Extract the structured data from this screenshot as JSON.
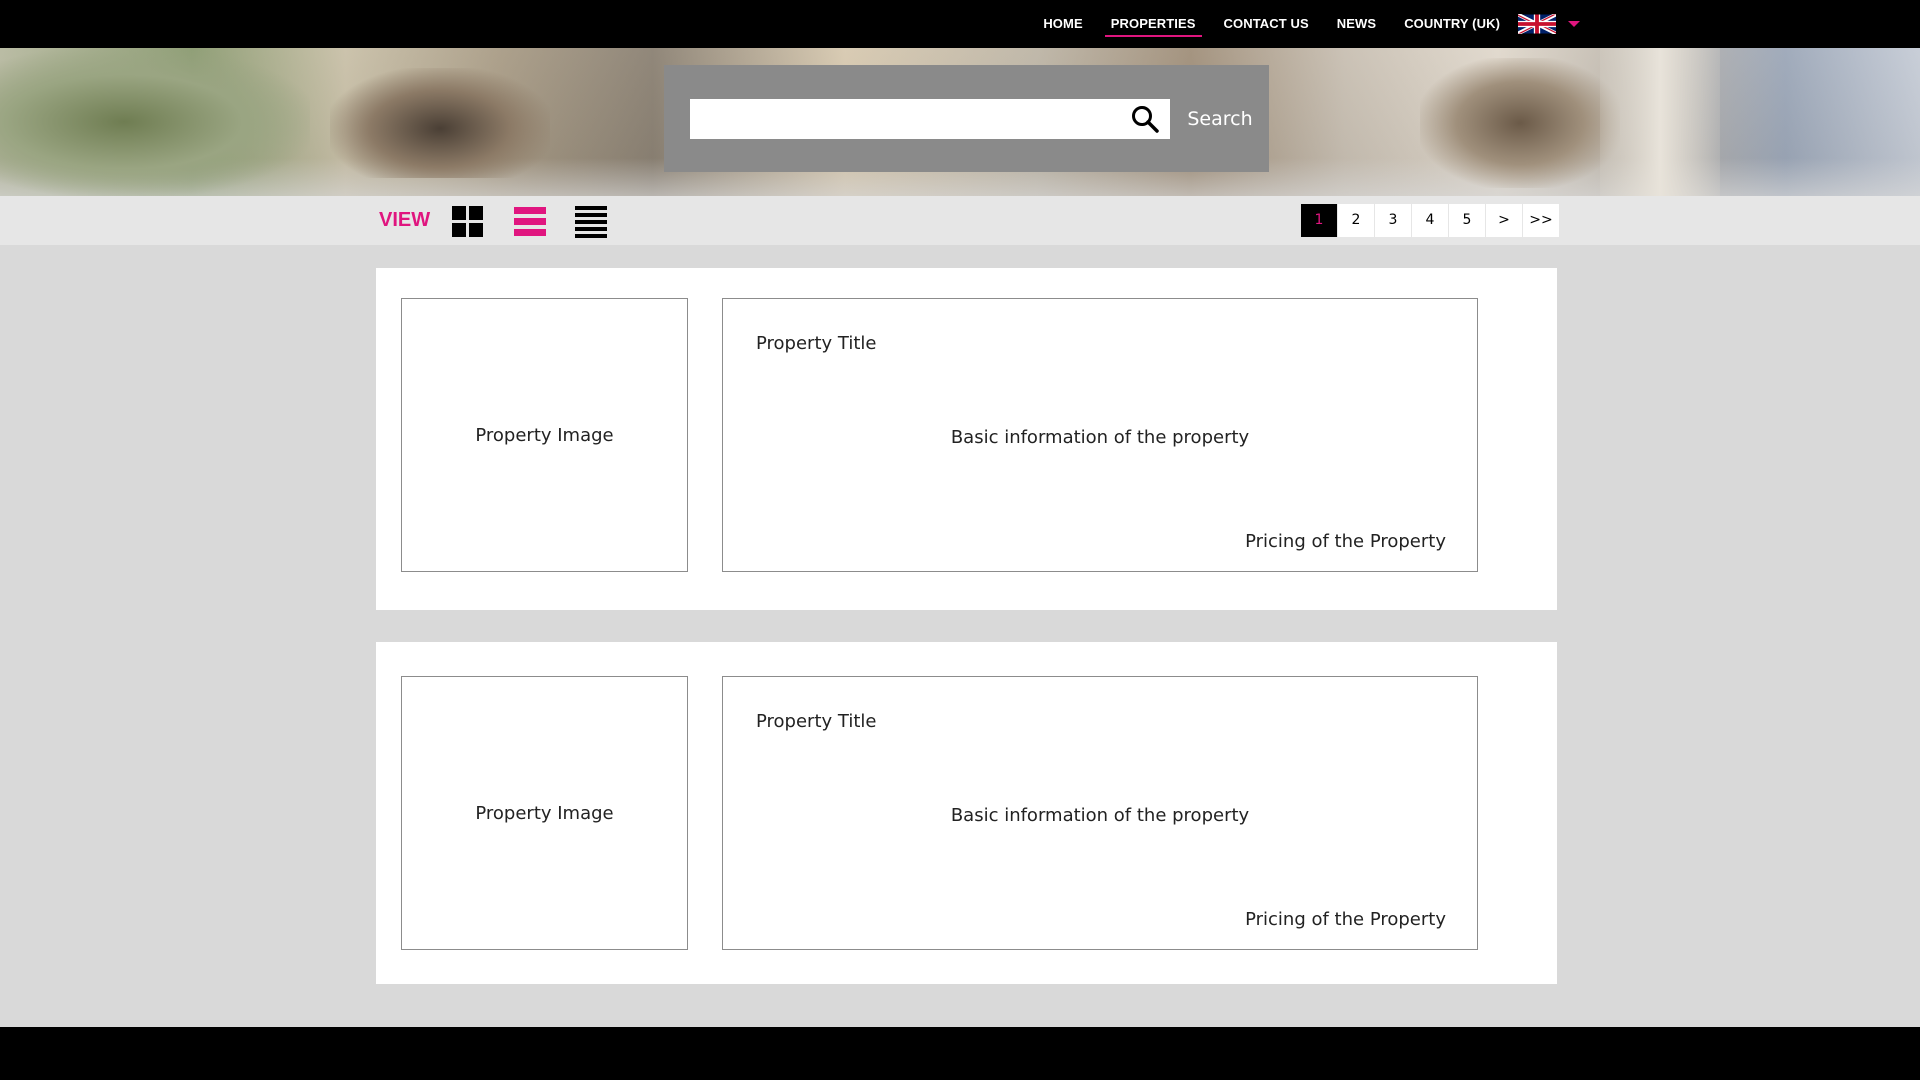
{
  "nav": {
    "items": [
      {
        "label": "HOME",
        "active": false
      },
      {
        "label": "PROPERTIES",
        "active": true
      },
      {
        "label": "CONTACT US",
        "active": false
      },
      {
        "label": "NEWS",
        "active": false
      }
    ],
    "country_label": "COUNTRY (UK)",
    "flag_icon": "uk-flag-icon",
    "accent_color": "#e0157f"
  },
  "search": {
    "value": "",
    "placeholder": "",
    "button_label": "Search",
    "icon": "search-icon"
  },
  "toolbar": {
    "view_label": "VIEW",
    "view_modes": [
      "grid-view-icon",
      "list-view-icon",
      "compact-list-view-icon"
    ],
    "active_view": "list-view-icon",
    "pages": [
      "1",
      "2",
      "3",
      "4",
      "5",
      ">",
      ">>"
    ],
    "current_page": "1"
  },
  "listings": [
    {
      "image_label": "Property Image",
      "title": "Property Title",
      "basic_info": "Basic information of the property",
      "pricing": "Pricing of the Property"
    },
    {
      "image_label": "Property Image",
      "title": "Property Title",
      "basic_info": "Basic information of the property",
      "pricing": "Pricing of the Property"
    }
  ]
}
